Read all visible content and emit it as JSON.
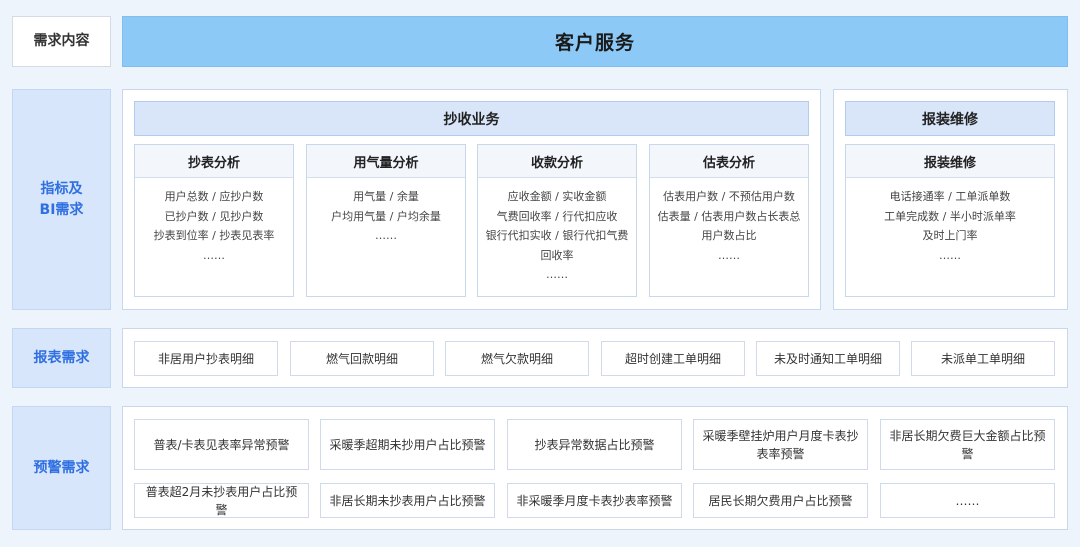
{
  "header": {
    "label": "需求内容",
    "banner": "客户服务"
  },
  "metrics": {
    "label_line1": "指标及",
    "label_line2": "BI需求",
    "billing": {
      "title": "抄收业务",
      "cards": [
        {
          "title": "抄表分析",
          "lines": [
            "用户总数 / 应抄户数",
            "已抄户数 / 见抄户数",
            "抄表到位率 / 抄表见表率",
            "……"
          ]
        },
        {
          "title": "用气量分析",
          "lines": [
            "用气量 / 余量",
            "户均用气量 / 户均余量",
            "……"
          ]
        },
        {
          "title": "收款分析",
          "lines": [
            "应收金额 / 实收金额",
            "气费回收率 / 行代扣应收",
            "银行代扣实收 / 银行代扣气费",
            "回收率",
            "……"
          ]
        },
        {
          "title": "估表分析",
          "lines": [
            "估表用户数 / 不预估用户数",
            "估表量 / 估表用户数占长表总",
            "用户数占比",
            "……"
          ]
        }
      ]
    },
    "repair": {
      "title": "报装维修",
      "cards": [
        {
          "title": "报装维修",
          "lines": [
            "电话接通率 / 工单派单数",
            "工单完成数 / 半小时派单率",
            "及时上门率",
            "……"
          ]
        }
      ]
    }
  },
  "reports": {
    "label": "报表需求",
    "items": [
      "非居用户抄表明细",
      "燃气回款明细",
      "燃气欠款明细",
      "超时创建工单明细",
      "未及时通知工单明细",
      "未派单工单明细"
    ]
  },
  "alerts": {
    "label": "预警需求",
    "items": [
      "普表/卡表见表率异常预警",
      "采暖季超期未抄用户占比预警",
      "抄表异常数据占比预警",
      "采暖季壁挂炉用户月度卡表抄表率预警",
      "非居长期欠费巨大金额占比预警",
      "普表超2月未抄表用户占比预警",
      "非居长期未抄表用户占比预警",
      "非采暖季月度卡表抄表率预警",
      "居民长期欠费用户占比预警",
      "……"
    ]
  }
}
